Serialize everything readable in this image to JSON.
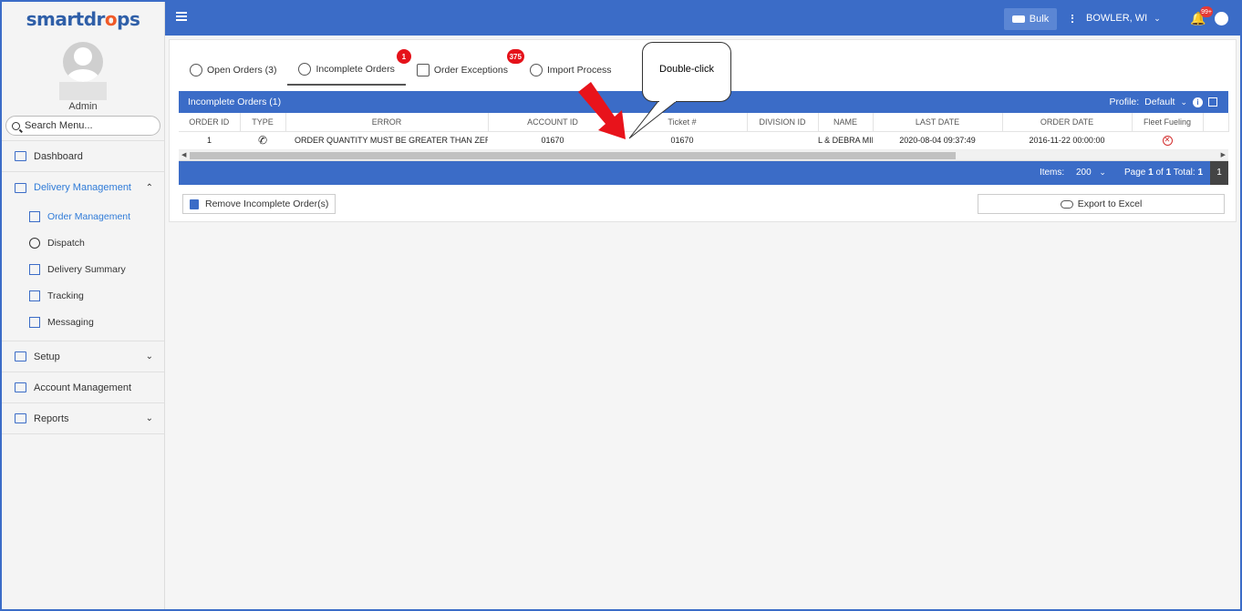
{
  "app": {
    "logo_text_a": "smartdr",
    "logo_text_b": "o",
    "logo_text_c": "ps"
  },
  "sidebar": {
    "user_name": "Admin",
    "search_placeholder": "Search Menu...",
    "items": [
      {
        "label": "Dashboard"
      },
      {
        "label": "Delivery Management"
      },
      {
        "label": "Setup"
      },
      {
        "label": "Account Management"
      },
      {
        "label": "Reports"
      }
    ],
    "sub_items": [
      {
        "label": "Order Management"
      },
      {
        "label": "Dispatch"
      },
      {
        "label": "Delivery Summary"
      },
      {
        "label": "Tracking"
      },
      {
        "label": "Messaging"
      }
    ]
  },
  "topbar": {
    "bulk_label": "Bulk",
    "location": "BOWLER, WI",
    "notification_count": "99+"
  },
  "tabs": [
    {
      "label": "Open Orders (3)",
      "badge": ""
    },
    {
      "label": "Incomplete Orders",
      "badge": "1"
    },
    {
      "label": "Order Exceptions",
      "badge": "375"
    },
    {
      "label": "Import Process",
      "badge": ""
    }
  ],
  "grid": {
    "title": "Incomplete Orders (1)",
    "profile_label": "Profile:",
    "profile_value": "Default",
    "columns": [
      "ORDER ID",
      "TYPE",
      "ERROR",
      "ACCOUNT ID",
      "Ticket #",
      "DIVISION ID",
      "NAME",
      "LAST DATE",
      "ORDER DATE",
      "Fleet Fueling"
    ],
    "rows": [
      {
        "order_id": "1",
        "error": "ORDER QUANTITY MUST BE GREATER THAN ZERO.",
        "account_id": "01670",
        "ticket": "01670",
        "division_id": "",
        "name": "L & DEBRA MILI",
        "last_date": "2020-08-04 09:37:49",
        "order_date": "2016-11-22 00:00:00"
      }
    ]
  },
  "pager": {
    "items_label": "Items:",
    "items_value": "200",
    "page_prefix": "Page",
    "page_current": "1",
    "page_of": "of",
    "page_total": "1",
    "total_label": "Total:",
    "total_value": "1",
    "page_button": "1"
  },
  "actions": {
    "remove_label": "Remove Incomplete Order(s)",
    "export_label": "Export to Excel"
  },
  "annotation": {
    "callout_text": "Double-click"
  },
  "colors": {
    "primary": "#3b6cc7",
    "accent": "#f05a28",
    "badge": "#e5121a",
    "annotation_arrow": "#e8131b"
  }
}
